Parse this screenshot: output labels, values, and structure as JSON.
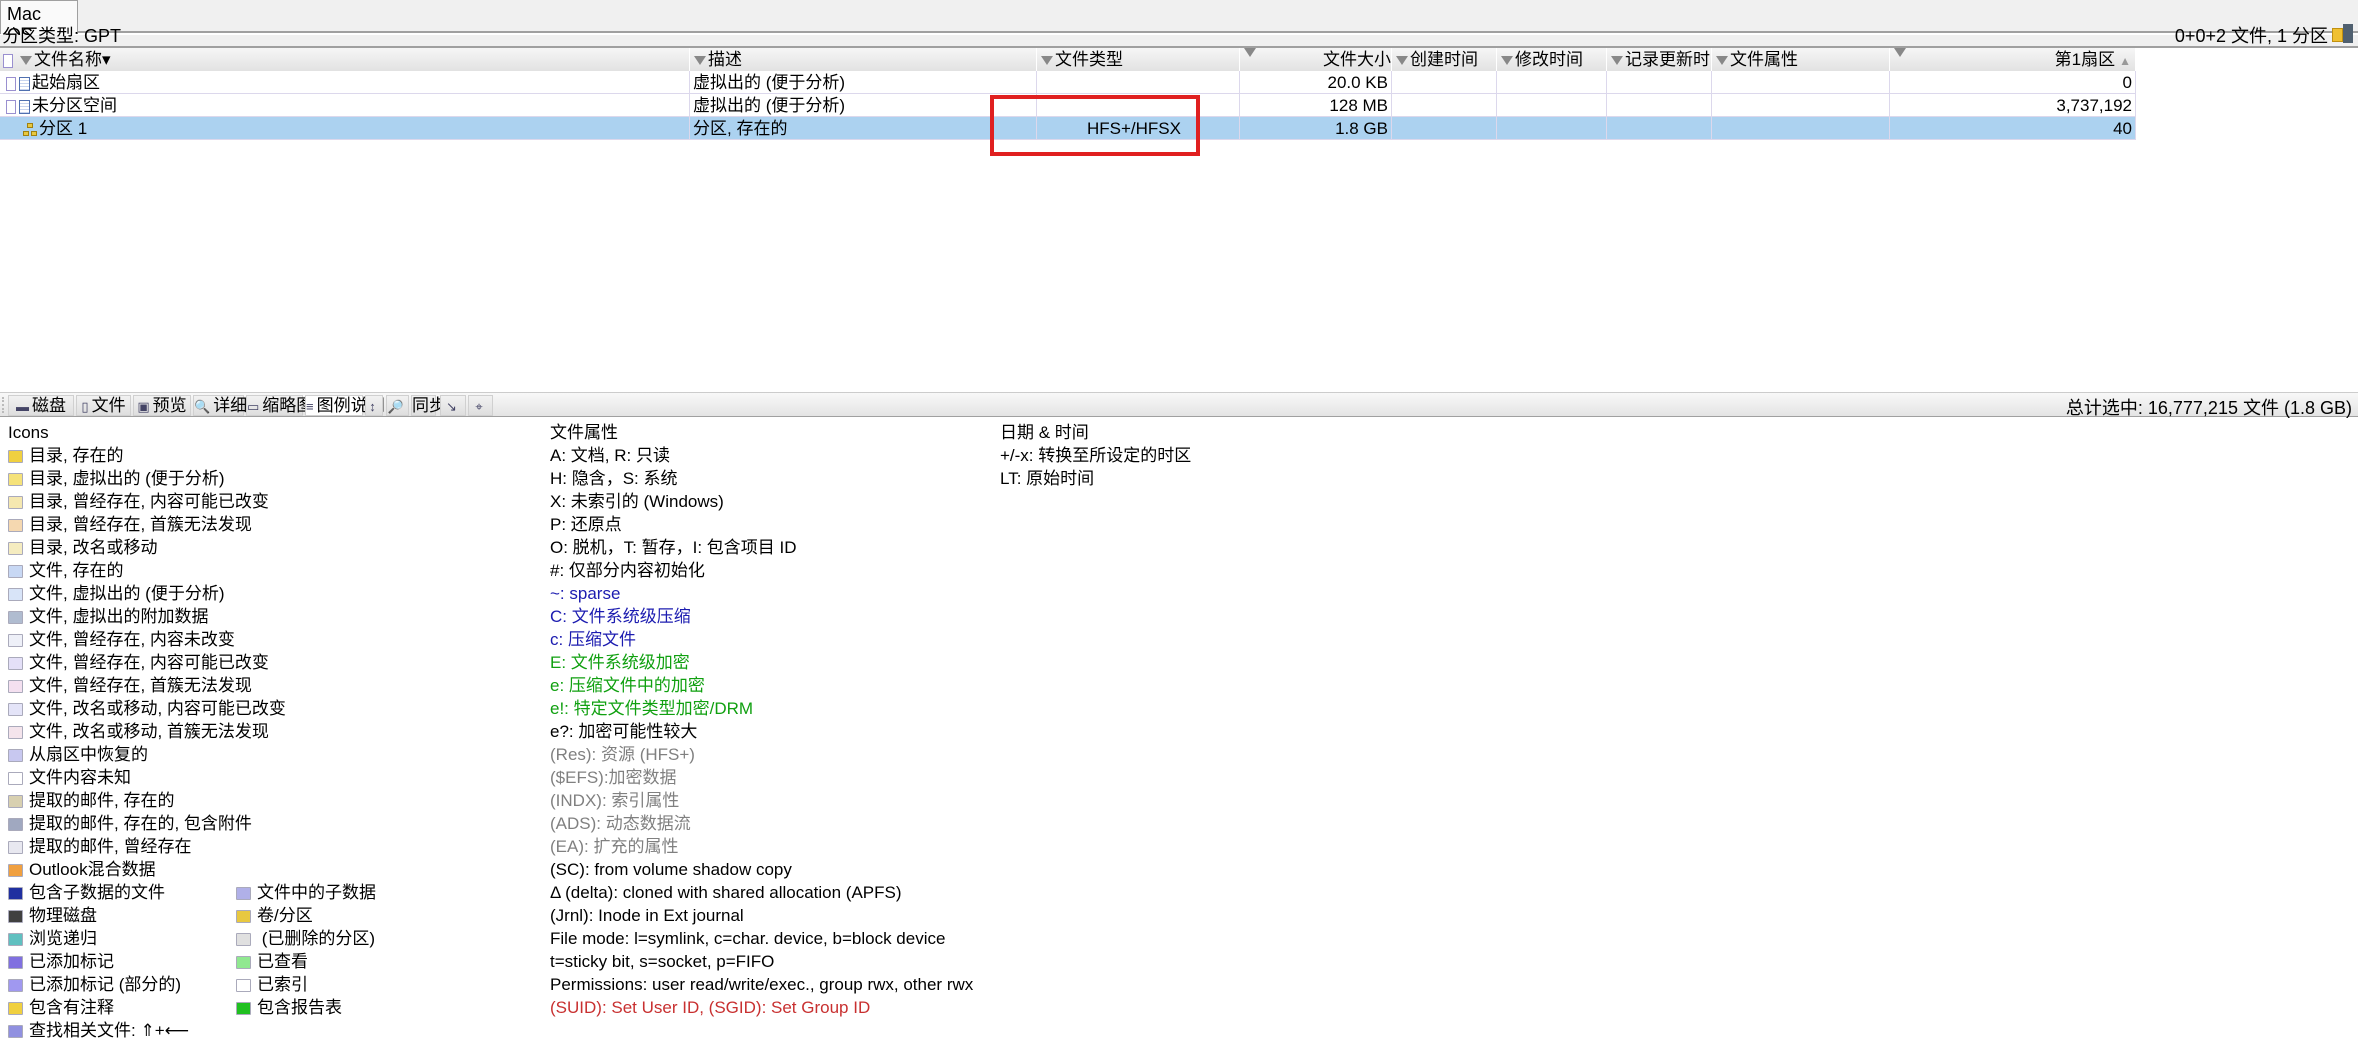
{
  "window": {
    "tab": "Mac OS",
    "partition_type": "分区类型: GPT",
    "summary": "0+0+2 文件, 1 分区"
  },
  "table": {
    "columns": [
      "文件名称",
      "描述",
      "文件类型",
      "文件大小",
      "创建时间",
      "修改时间",
      "记录更新时",
      "文件属性",
      "第1扇区"
    ],
    "rows": [
      {
        "icon": "file-virtual",
        "name": "起始扇区",
        "desc": "虚拟出的 (便于分析)",
        "type": "",
        "size": "20.0 KB",
        "created": "",
        "modified": "",
        "record": "",
        "attrs": "",
        "first_sector": "0",
        "selected": false
      },
      {
        "icon": "file-virtual",
        "name": "未分区空间",
        "desc": "虚拟出的 (便于分析)",
        "type": "",
        "size": "128 MB",
        "created": "",
        "modified": "",
        "record": "",
        "attrs": "",
        "first_sector": "3,737,192",
        "selected": false
      },
      {
        "icon": "partition",
        "name": "分区 1",
        "desc": "分区, 存在的",
        "type": "HFS+/HFSX",
        "size": "1.8 GB",
        "created": "",
        "modified": "",
        "record": "",
        "attrs": "",
        "first_sector": "40",
        "selected": true
      }
    ]
  },
  "bottom_tabs": [
    {
      "label": "磁盘",
      "icon": "disk-icon"
    },
    {
      "label": "文件",
      "icon": "file-icon"
    },
    {
      "label": "预览",
      "icon": "preview-icon"
    },
    {
      "label": "详细",
      "icon": "details-icon"
    },
    {
      "label": "缩略图",
      "icon": "thumbnail-icon"
    },
    {
      "label": "图例说明",
      "icon": "legend-icon",
      "active": true
    },
    {
      "label": "",
      "icon": "resize-icon"
    },
    {
      "label": "",
      "icon": "search-folder-icon"
    },
    {
      "label": "同步",
      "icon": ""
    },
    {
      "label": "",
      "icon": "arrow-icon"
    },
    {
      "label": "",
      "icon": "target-icon"
    }
  ],
  "status": "总计选中: 16,777,215 文件 (1.8 GB)",
  "legend": {
    "icons_title": "Icons",
    "icons": [
      {
        "text": "目录, 存在的",
        "color": "#f0d040"
      },
      {
        "text": "目录, 虚拟出的 (便于分析)",
        "color": "#f5e27a"
      },
      {
        "text": "目录, 曾经存在, 内容可能已改变",
        "color": "#f5e8b0"
      },
      {
        "text": "目录, 曾经存在, 首簇无法发现",
        "color": "#f5d8b0"
      },
      {
        "text": "目录, 改名或移动",
        "color": "#f5ecc0"
      },
      {
        "text": "文件, 存在的",
        "color": "#c8d8f4"
      },
      {
        "text": "文件, 虚拟出的 (便于分析)",
        "color": "#d8e4f8"
      },
      {
        "text": "文件, 虚拟出的附加数据",
        "color": "#b0bcd0"
      },
      {
        "text": "文件, 曾经存在, 内容未改变",
        "color": "#eef0f8"
      },
      {
        "text": "文件, 曾经存在, 内容可能已改变",
        "color": "#e4e0f8"
      },
      {
        "text": "文件, 曾经存在, 首簇无法发现",
        "color": "#f4e0f0"
      },
      {
        "text": "文件, 改名或移动, 内容可能已改变",
        "color": "#e4e4f8"
      },
      {
        "text": "文件, 改名或移动, 首簇无法发现",
        "color": "#f4e4ec"
      },
      {
        "text": "从扇区中恢复的",
        "color": "#c8c8f0"
      },
      {
        "text": "文件内容未知",
        "color": "#ffffff"
      },
      {
        "text": "提取的邮件, 存在的",
        "color": "#d8d0b0"
      },
      {
        "text": "提取的邮件, 存在的, 包含附件",
        "color": "#a0a8c0"
      },
      {
        "text": "提取的邮件, 曾经存在",
        "color": "#e8e8f0"
      },
      {
        "text": "Outlook混合数据",
        "color": "#f0a040"
      }
    ],
    "icon_pairs": [
      [
        {
          "text": "包含子数据的文件",
          "color": "#2030a0"
        },
        {
          "text": "文件中的子数据",
          "color": "#b0b0e8"
        }
      ],
      [
        {
          "text": "物理磁盘",
          "color": "#404040"
        },
        {
          "text": "卷/分区",
          "color": "#e8c840"
        }
      ],
      [
        {
          "text": "浏览递归",
          "color": "#60c0c0"
        },
        {
          "text": " (已删除的分区)",
          "color": "#e0e0e0"
        }
      ],
      [
        {
          "text": "已添加标记",
          "color": "#8070e0"
        },
        {
          "text": "已查看",
          "color": "#90e890"
        }
      ],
      [
        {
          "text": "已添加标记 (部分的)",
          "color": "#a098f0"
        },
        {
          "text": "已索引",
          "color": "#ffffff"
        }
      ],
      [
        {
          "text": "包含有注释",
          "color": "#f0d040"
        },
        {
          "text": "包含报告表",
          "color": "#20c020"
        }
      ],
      [
        {
          "text": "查找相关文件: ⇑+⟵",
          "color": "#9090e0"
        },
        null
      ]
    ],
    "attributes_title": "文件属性",
    "attributes": [
      {
        "text": "A: 文档, R: 只读",
        "color": "#000000"
      },
      {
        "text": "H: 隐含，S: 系统",
        "color": "#000000"
      },
      {
        "text": "X: 未索引的 (Windows)",
        "color": "#000000"
      },
      {
        "text": "P: 还原点",
        "color": "#000000"
      },
      {
        "text": "O: 脱机，T: 暂存，I: 包含项目 ID",
        "color": "#000000"
      },
      {
        "text": "#: 仅部分内容初始化",
        "color": "#000000"
      },
      {
        "text": "~: sparse",
        "color": "#1c1cb0"
      },
      {
        "text": "C: 文件系统级压缩",
        "color": "#1c1cb0"
      },
      {
        "text": "c: 压缩文件",
        "color": "#1c1cb0"
      },
      {
        "text": "E: 文件系统级加密",
        "color": "#10a010"
      },
      {
        "text": "e: 压缩文件中的加密",
        "color": "#10a010"
      },
      {
        "text": "e!: 特定文件类型加密/DRM",
        "color": "#10a010"
      },
      {
        "text": "e?: 加密可能性较大",
        "color": "#000000"
      },
      {
        "text": "(Res): 资源 (HFS+)",
        "color": "#808080"
      },
      {
        "text": "($EFS):加密数据",
        "color": "#808080"
      },
      {
        "text": "(INDX): 索引属性",
        "color": "#808080"
      },
      {
        "text": "(ADS): 动态数据流",
        "color": "#808080"
      },
      {
        "text": "(EA): 扩充的属性",
        "color": "#808080"
      },
      {
        "text": "(SC): from volume shadow copy",
        "color": "#000000"
      },
      {
        "text": "Δ (delta): cloned with shared allocation (APFS)",
        "color": "#000000"
      },
      {
        "text": "(Jrnl): Inode in Ext journal",
        "color": "#000000"
      },
      {
        "text": "File mode: l=symlink, c=char. device, b=block device",
        "color": "#000000"
      },
      {
        "text": "t=sticky bit, s=socket, p=FIFO",
        "color": "#000000"
      },
      {
        "text": "Permissions: user read/write/exec., group rwx, other rwx",
        "color": "#000000"
      },
      {
        "text": "(SUID): Set User ID, (SGID): Set Group ID",
        "color": "#c83030"
      }
    ],
    "datetime_title": "日期 & 时间",
    "datetime": [
      "+/-x: 转换至所设定的时区",
      "LT: 原始时间"
    ]
  },
  "colors": {
    "selection": "#acd2f0",
    "highlight_box": "#e02020"
  }
}
